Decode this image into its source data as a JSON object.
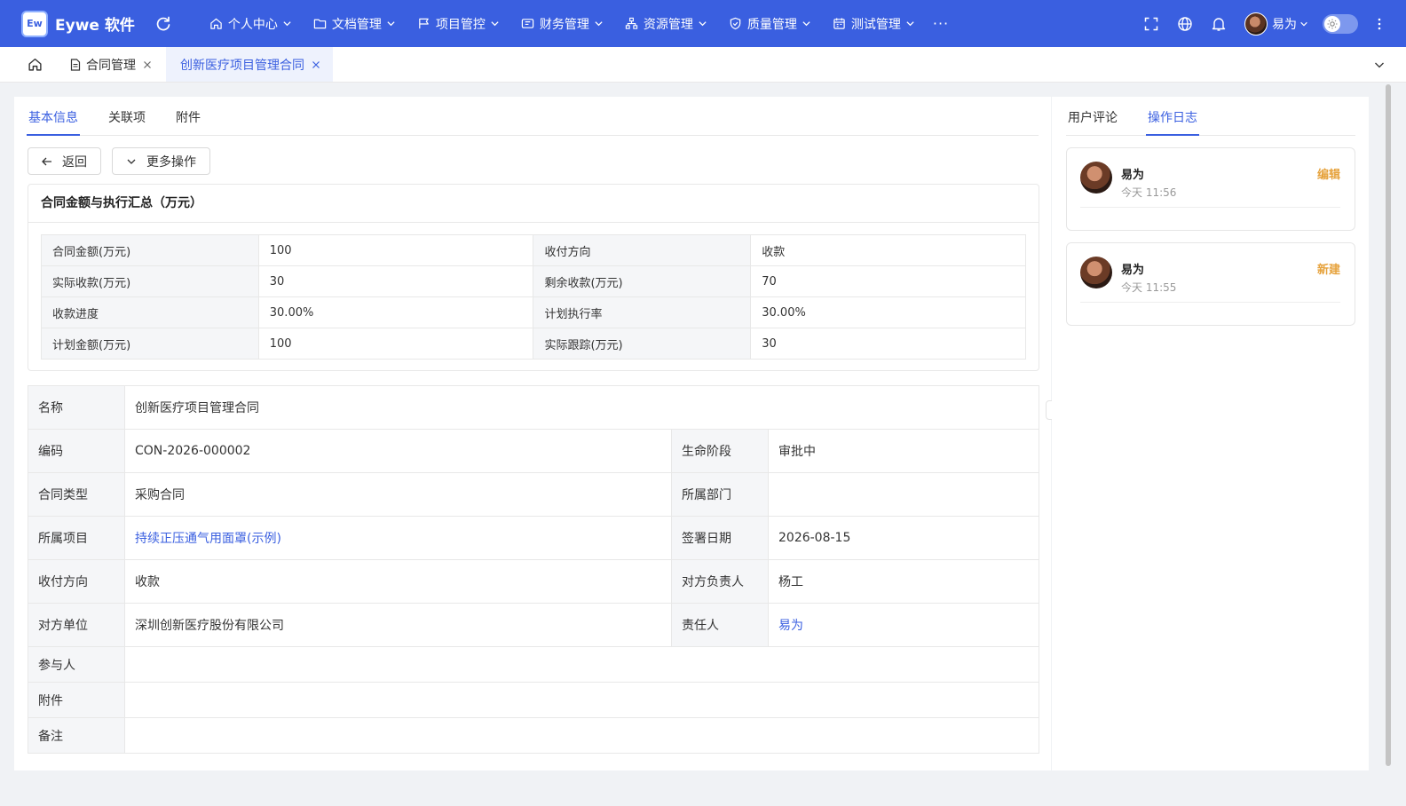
{
  "app": {
    "logo_text": "Ew",
    "name": "Eywe 软件"
  },
  "nav": {
    "items": [
      {
        "label": "个人中心",
        "icon": "home-icon"
      },
      {
        "label": "文档管理",
        "icon": "folder-icon"
      },
      {
        "label": "项目管控",
        "icon": "flag-icon"
      },
      {
        "label": "财务管理",
        "icon": "finance-icon"
      },
      {
        "label": "资源管理",
        "icon": "org-icon"
      },
      {
        "label": "质量管理",
        "icon": "shield-icon"
      },
      {
        "label": "测试管理",
        "icon": "calendar-icon"
      }
    ],
    "more": "···"
  },
  "user": {
    "name": "易为"
  },
  "tabs": [
    {
      "label": "合同管理"
    },
    {
      "label": "创新医疗项目管理合同"
    }
  ],
  "subtabs": [
    "基本信息",
    "关联项",
    "附件"
  ],
  "buttons": {
    "back": "返回",
    "more": "更多操作"
  },
  "summary": {
    "title": "合同金额与执行汇总（万元）",
    "rows": [
      [
        "合同金额(万元)",
        "100",
        "收付方向",
        "收款"
      ],
      [
        "实际收款(万元)",
        "30",
        "剩余收款(万元)",
        "70"
      ],
      [
        "收款进度",
        "30.00%",
        "计划执行率",
        "30.00%"
      ],
      [
        "计划金额(万元)",
        "100",
        "实际跟踪(万元)",
        "30"
      ]
    ]
  },
  "detail": {
    "name": {
      "label": "名称",
      "value": "创新医疗项目管理合同"
    },
    "rows": [
      [
        "编码",
        "CON-2026-000002",
        "生命阶段",
        "审批中"
      ],
      [
        "合同类型",
        "采购合同",
        "所属部门",
        ""
      ],
      [
        "所属项目",
        "持续正压通气用面罩(示例)",
        "签署日期",
        "2026-08-15"
      ],
      [
        "收付方向",
        "收款",
        "对方负责人",
        "杨工"
      ],
      [
        "对方单位",
        "深圳创新医疗股份有限公司",
        "责任人",
        "易为"
      ]
    ],
    "participants": {
      "label": "参与人",
      "value": ""
    },
    "attachments": {
      "label": "附件",
      "value": ""
    },
    "remarks": {
      "label": "备注",
      "value": ""
    }
  },
  "right_tabs": [
    "用户评论",
    "操作日志"
  ],
  "logs": [
    {
      "user": "易为",
      "time": "今天 11:56",
      "action": "编辑"
    },
    {
      "user": "易为",
      "time": "今天 11:55",
      "action": "新建"
    }
  ]
}
